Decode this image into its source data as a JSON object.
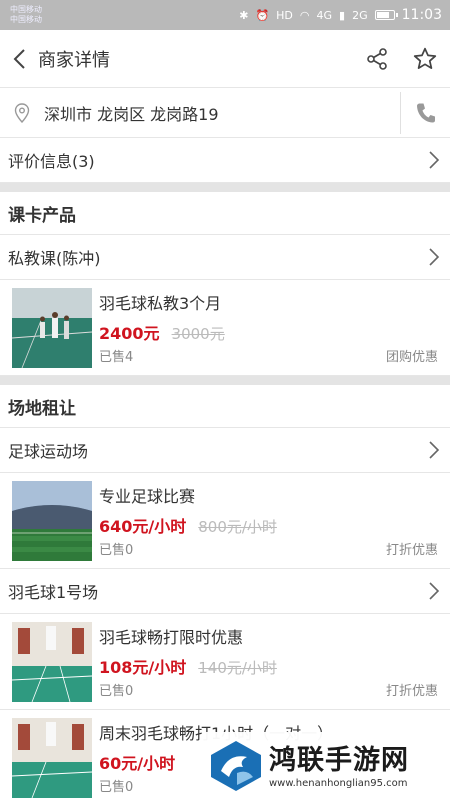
{
  "status_bar": {
    "carrier1": "中国移动",
    "carrier2": "中国移动",
    "network1": "4G",
    "network2": "2G",
    "time": "11:03",
    "battery_level": 0.8
  },
  "header": {
    "title": "商家详情"
  },
  "address": "深圳市 龙岗区 龙岗路19",
  "reviews": "评价信息(3)",
  "section_courses": {
    "title": "课卡产品",
    "category": "私教课(陈冲)",
    "products": [
      {
        "name": "羽毛球私教3个月",
        "price": "2400元",
        "original": "3000元",
        "sold": "已售4",
        "tag": "团购优惠"
      }
    ]
  },
  "section_venues": {
    "title": "场地租让",
    "category1": "足球运动场",
    "products1": [
      {
        "name": "专业足球比赛",
        "price": "640元/小时",
        "original": "800元/小时",
        "sold": "已售0",
        "tag": "打折优惠"
      }
    ],
    "category2": "羽毛球1号场",
    "products2": [
      {
        "name": "羽毛球畅打限时优惠",
        "price": "108元/小时",
        "original": "140元/小时",
        "sold": "已售0",
        "tag": "打折优惠"
      },
      {
        "name": "周末羽毛球畅打1小时（一对一）",
        "price": "60元/小时",
        "original": "",
        "sold": "已售0",
        "tag": ""
      }
    ]
  },
  "watermark": {
    "title": "鸿联手游网",
    "url": "www.henanhonglian95.com"
  },
  "colors": {
    "price_red": "#d0141f",
    "status_bar": "#b9b9b9",
    "divider": "#e4e4e4"
  }
}
